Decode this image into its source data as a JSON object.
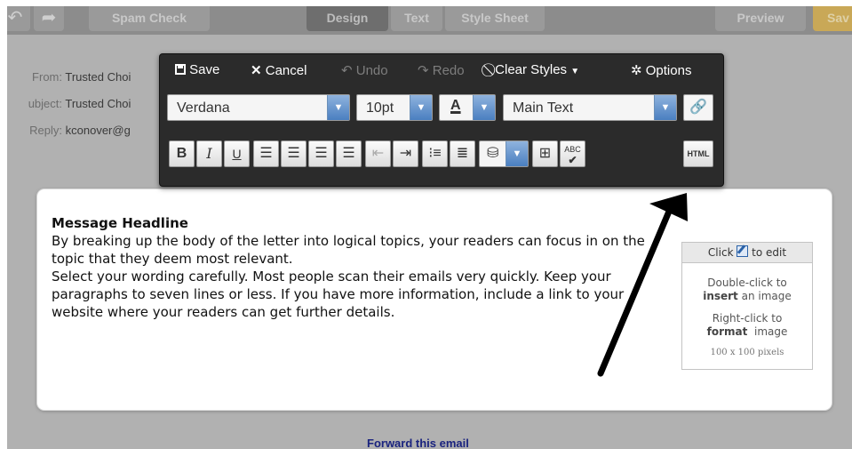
{
  "topbar": {
    "spam_check": "Spam Check",
    "tab_design": "Design",
    "tab_text": "Text",
    "tab_style_sheet": "Style Sheet",
    "preview": "Preview",
    "save": "Sav"
  },
  "header_fields": [
    {
      "label": "From:",
      "value": "Trusted Choi"
    },
    {
      "label": "ubject:",
      "value": "Trusted Choi"
    },
    {
      "label": "Reply:",
      "value": "kconover@g"
    }
  ],
  "toolbar": {
    "save": "Save",
    "cancel": "Cancel",
    "undo": "Undo",
    "redo": "Redo",
    "clear_styles": "Clear Styles",
    "options": "Options",
    "font_family": "Verdana",
    "font_size": "10pt",
    "style": "Main Text",
    "color_letter": "A",
    "bold": "B",
    "italic": "I",
    "underline": "U",
    "html": "HTML",
    "spell": "ABC"
  },
  "message": {
    "headline": "Message Headline",
    "para1": "By breaking up the body of the letter into logical topics, your readers can focus in on the topic that they deem most relevant.",
    "para2": "Select your wording carefully. Most people scan their emails very quickly. Keep your paragraphs to seven lines or less. If you have more information, include a link to your website where your readers can get further details."
  },
  "image_placeholder": {
    "click_prefix": "Click",
    "click_suffix": "to edit",
    "dbl_line1": "Double-click to",
    "dbl_bold": "insert",
    "dbl_rest": "an image",
    "right_line1": "Right-click to",
    "right_bold": "format",
    "right_rest": "image",
    "size": "100 x 100 pixels"
  },
  "footer": {
    "forward": "Forward this email"
  },
  "colors": {
    "accent_blue": "#4a7fc0",
    "toolbar_bg": "#2b2b2b",
    "page_bg": "#b1b1b1"
  }
}
